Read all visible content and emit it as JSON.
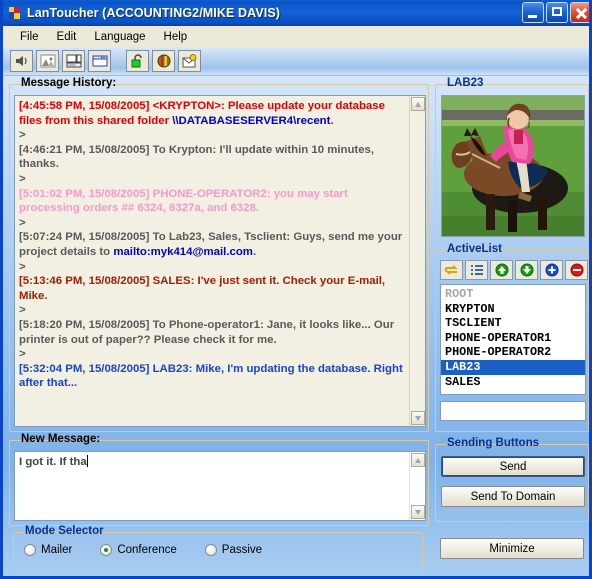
{
  "window": {
    "title": "LanToucher (ACCOUNTING2/MIKE DAVIS)",
    "logo_icon": "lantoucher-logo-icon",
    "minimize_icon": "minimize-icon",
    "maximize_icon": "maximize-icon",
    "close_icon": "close-icon"
  },
  "menu": {
    "items": [
      {
        "label": "File"
      },
      {
        "label": "Edit"
      },
      {
        "label": "Language"
      },
      {
        "label": "Help"
      }
    ]
  },
  "toolbar": {
    "buttons": [
      {
        "icon": "speaker-sound-icon",
        "label": "Sound"
      },
      {
        "icon": "image-picture-icon",
        "label": "Picture"
      },
      {
        "icon": "computer-monitor-icon",
        "label": "Computer"
      },
      {
        "icon": "window-icon",
        "label": "Window"
      },
      {
        "icon": "open-padlock-icon",
        "label": "Lock"
      },
      {
        "icon": "color-circle-icon",
        "label": "Colors"
      },
      {
        "icon": "mail-envelope-icon",
        "label": "Mail"
      }
    ]
  },
  "history": {
    "legend": "Message History:",
    "legend_accesskey": "y",
    "messages": [
      {
        "color": "red",
        "parts": [
          {
            "text": "[4:45:58 PM, 15/08/2005] <KRYPTON>: Please update your database files from this shared folder "
          },
          {
            "text": "\\\\DATABASESERVER4\\recent",
            "link": true
          },
          {
            "text": "."
          }
        ]
      },
      {
        "color": "plain",
        "parts": [
          {
            "text": ">"
          }
        ]
      },
      {
        "color": "plain",
        "parts": [
          {
            "text": "[4:46:21 PM, 15/08/2005] To Krypton: I'll update within 10 minutes, thanks."
          }
        ]
      },
      {
        "color": "plain",
        "parts": [
          {
            "text": ">"
          }
        ]
      },
      {
        "color": "pink",
        "parts": [
          {
            "text": "[5:01:02 PM, 15/08/2005] PHONE-OPERATOR2: you may start processing orders ## 6324, 6327a, and 6328."
          }
        ]
      },
      {
        "color": "plain",
        "parts": [
          {
            "text": ">"
          }
        ]
      },
      {
        "color": "plain",
        "parts": [
          {
            "text": "[5:07:24 PM, 15/08/2005] To Lab23, Sales, Tsclient: Guys, send me your project details to "
          },
          {
            "text": "mailto:myk414@mail.com",
            "link": true
          },
          {
            "text": "."
          }
        ]
      },
      {
        "color": "plain",
        "parts": [
          {
            "text": ">"
          }
        ]
      },
      {
        "color": "darkred",
        "parts": [
          {
            "text": "[5:13:46 PM, 15/08/2005] SALES: I've just sent it. Check your E-mail, Mike."
          }
        ]
      },
      {
        "color": "plain",
        "parts": [
          {
            "text": ">"
          }
        ]
      },
      {
        "color": "plain",
        "parts": [
          {
            "text": "[5:18:20 PM, 15/08/2005] To Phone-operator1: Jane, it looks like... Our printer is out of paper?? Please check it for me."
          }
        ]
      },
      {
        "color": "plain",
        "parts": [
          {
            "text": ">"
          }
        ]
      },
      {
        "color": "blue",
        "parts": [
          {
            "text": "[5:32:04 PM, 15/08/2005] LAB23: Mike, I'm updating the database. Right after that..."
          }
        ]
      }
    ],
    "scroll_up_icon": "scroll-up-arrow-icon",
    "scroll_down_icon": "scroll-down-arrow-icon"
  },
  "new_message": {
    "legend": "New Message:",
    "legend_accesskey": "M",
    "value": "I got it. If tha",
    "placeholder": "",
    "scroll_up_icon": "scroll-up-arrow-icon",
    "scroll_down_icon": "scroll-down-arrow-icon"
  },
  "mode_selector": {
    "legend": "Mode Selector",
    "options": [
      {
        "label": "Mailer",
        "accesskey": "i",
        "selected": false
      },
      {
        "label": "Conference",
        "accesskey": "o",
        "selected": true
      },
      {
        "label": "Passive",
        "accesskey": "v",
        "selected": false
      }
    ]
  },
  "contact_panel": {
    "legend": "LAB23",
    "avatar_alt": "woman-riding-horse-photo"
  },
  "active_list": {
    "legend": "ActiveList",
    "tools": [
      {
        "icon": "refresh-arrows-icon",
        "label": "Refresh"
      },
      {
        "icon": "list-view-icon",
        "label": "List"
      },
      {
        "icon": "move-up-icon",
        "label": "Move Up"
      },
      {
        "icon": "move-down-icon",
        "label": "Move Down"
      },
      {
        "icon": "add-plus-icon",
        "label": "Add"
      },
      {
        "icon": "remove-minus-icon",
        "label": "Remove"
      }
    ],
    "items": [
      {
        "label": "ROOT",
        "state": "root"
      },
      {
        "label": "KRYPTON",
        "state": "normal"
      },
      {
        "label": "TSCLIENT",
        "state": "normal"
      },
      {
        "label": "PHONE-OPERATOR1",
        "state": "normal"
      },
      {
        "label": "PHONE-OPERATOR2",
        "state": "normal"
      },
      {
        "label": "LAB23",
        "state": "selected"
      },
      {
        "label": "SALES",
        "state": "normal"
      }
    ],
    "input_value": "",
    "input_placeholder": ""
  },
  "sending": {
    "legend": "Sending Buttons",
    "send_label": "Send",
    "send_accesskey": "S",
    "send_domain_label": "Send To Domain",
    "send_domain_accesskey": "a",
    "minimize_label": "Minimize",
    "minimize_accesskey": "z"
  },
  "colors": {
    "titlebar_blue": "#0a53c4",
    "accent_blue": "#003399",
    "selection_blue": "#1b5fc4",
    "message_red": "#e00000",
    "message_pink": "#f79bc8",
    "message_darkred": "#a02000",
    "message_blue": "#1a44cc",
    "link_blue": "#0000cc",
    "history_bg": "#f2efe3",
    "menu_bg": "#ece9d8"
  }
}
